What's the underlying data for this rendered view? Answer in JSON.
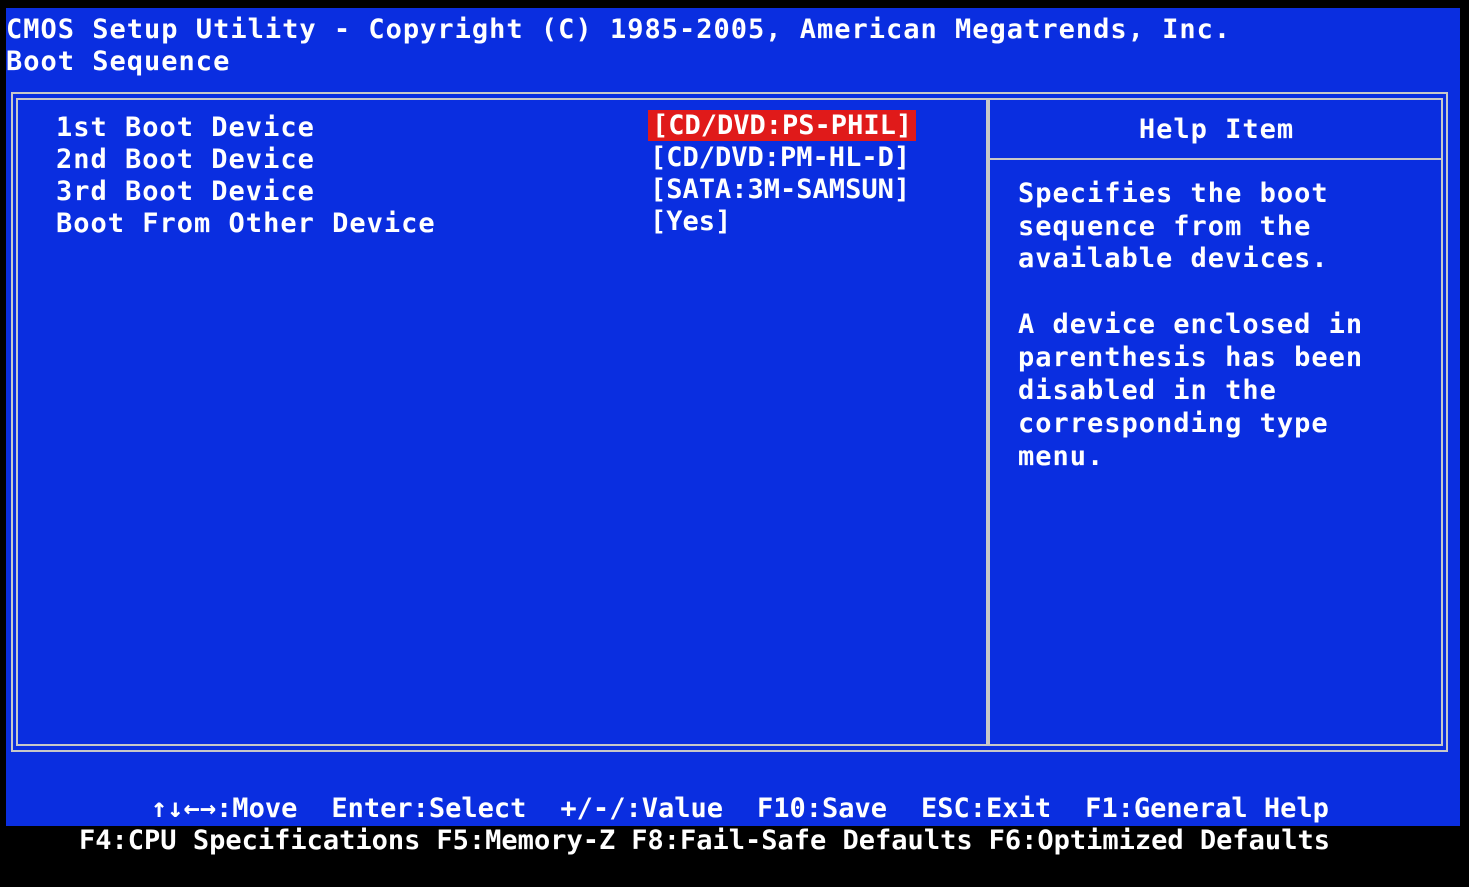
{
  "header": {
    "title": "CMOS Setup Utility - Copyright (C) 1985-2005, American Megatrends, Inc.",
    "subtitle": "Boot Sequence"
  },
  "menu": {
    "items": [
      {
        "label": "1st Boot Device",
        "value": "[CD/DVD:PS-PHIL]",
        "selected": true
      },
      {
        "label": "2nd Boot Device",
        "value": "[CD/DVD:PM-HL-D]",
        "selected": false
      },
      {
        "label": "3rd Boot Device",
        "value": "[SATA:3M-SAMSUN]",
        "selected": false
      },
      {
        "label": "Boot From Other Device",
        "value": "[Yes]",
        "selected": false
      }
    ]
  },
  "help": {
    "title": "Help Item",
    "lines": [
      "Specifies the boot",
      "sequence from the",
      "available devices.",
      "",
      "A device enclosed in",
      "parenthesis has been",
      "disabled in the",
      "corresponding type",
      "menu."
    ]
  },
  "footer": {
    "row1": [
      "↑↓←→:Move",
      "Enter:Select",
      "+/-/:Value",
      "F10:Save",
      "ESC:Exit",
      "F1:General Help"
    ],
    "row2": [
      "F4:CPU Specifications",
      "F5:Memory-Z",
      "F8:Fail-Safe Defaults",
      "F6:Optimized Defaults"
    ]
  },
  "colors": {
    "background": "#0a2ee0",
    "text": "#ffffff",
    "highlight": "#e01a1a",
    "border": "#c8c8c8"
  }
}
